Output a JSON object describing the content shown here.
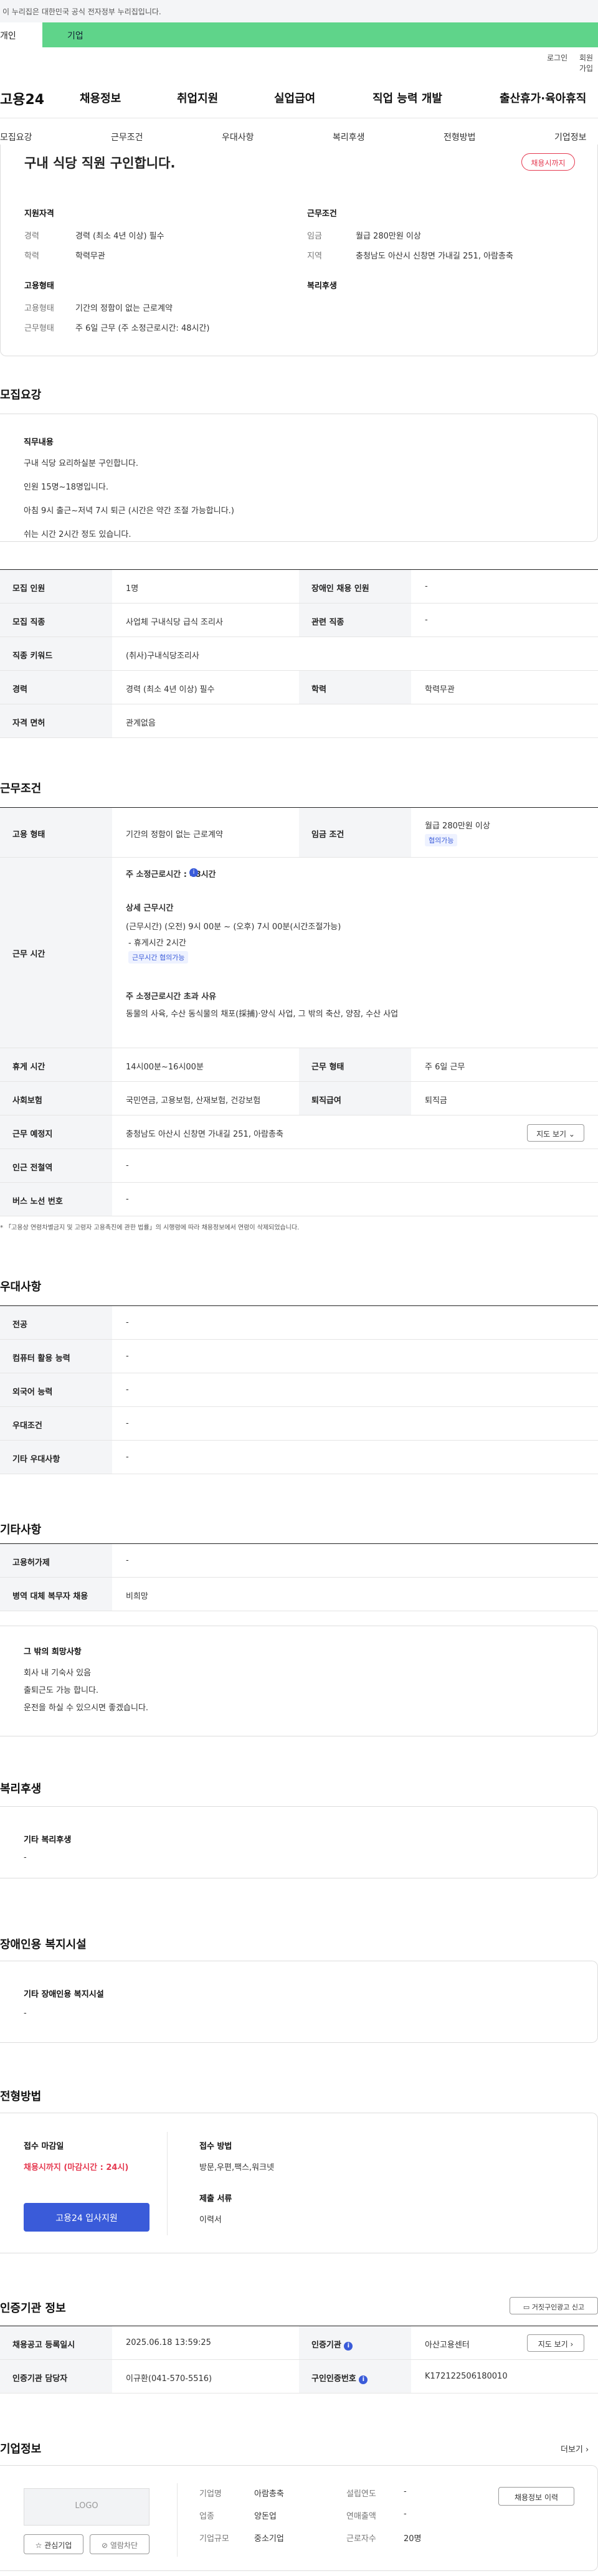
{
  "top_notice": "이 누리집은 대한민국 공식 전자정부 누리집입니다.",
  "role_tabs": {
    "left": "개인",
    "right": "기업"
  },
  "util": {
    "login": "로그인",
    "join": "회원가입"
  },
  "logo": "고용24",
  "gnb": [
    "채용정보",
    "취업지원",
    "실업급여",
    "직업 능력 개발",
    "출산휴가·육아휴직"
  ],
  "subnav": [
    "모집요강",
    "근무조건",
    "우대사항",
    "복리후생",
    "전형방법",
    "기업정보"
  ],
  "summary": {
    "title": "구내 식당 직원 구인합니다.",
    "status_badge": "채용시까지",
    "qual_title": "지원자격",
    "career_label": "경력",
    "career_value": "경력 (최소 4년 이상) 필수",
    "edu_label": "학력",
    "edu_value": "학력무관",
    "cond_title": "근무조건",
    "wage_label": "임금",
    "wage_value": "월급 280만원 이상",
    "region_label": "지역",
    "region_value": "충청남도 아산시 신창면 가내길 251, 아람총축",
    "emp_title": "고용형태",
    "emp_type_label": "고용형태",
    "emp_type_value": "기간의 정함이 없는 근로계약",
    "work_type_label": "근무형태",
    "work_type_value": "주 6일 근무 (주 소정근로시간: 48시간)",
    "welfare_title": "복리후생"
  },
  "recruit": {
    "heading": "모집요강",
    "desc_title": "직무내용",
    "desc_lines": [
      "구내 식당 요리하실분 구인합니다.",
      "인원 15명~18명입니다.",
      "아침 9시 출근~저녁 7시 퇴근 (시간은 약간 조절 가능합니다.)",
      "쉬는 시간 2시간 정도 있습니다."
    ],
    "rows": [
      {
        "k1": "모집 인원",
        "v1": "1명",
        "k2": "장애인 채용 인원",
        "v2": "-"
      },
      {
        "k1": "모집 직종",
        "v1": "사업체 구내식당 급식 조리사",
        "k2": "관련 직종",
        "v2": "-"
      },
      {
        "k1": "직종 키워드",
        "v1": "(취사)구내식당조리사",
        "k2": "",
        "v2": ""
      },
      {
        "k1": "경력",
        "v1": "경력 (최소 4년 이상) 필수",
        "k2": "학력",
        "v2": "학력무관"
      },
      {
        "k1": "자격 면허",
        "v1": "관계없음",
        "k2": "",
        "v2": ""
      }
    ]
  },
  "conditions": {
    "heading": "근무조건",
    "emp_type_k": "고용 형태",
    "emp_type_v": "기간의 정함이 없는 근로계약",
    "wage_k": "임금 조건",
    "wage_v": "월급 280만원 이상",
    "wage_badge": "협의가능",
    "hours_k": "근무 시간",
    "hours_total": "주 소정근로시간 : 48시간",
    "hours_detail_title": "상세 근무시간",
    "hours_detail_1": "(근무시간) (오전) 9시 00분 ~ (오후) 7시 00분(시간조절가능)",
    "hours_detail_2": "- 휴게시간 2시간",
    "hours_badge": "근무시간 협의가능",
    "hours_over_title": "주 소정근로시간 초과 사유",
    "hours_over_value": "동물의 사육, 수산 동식물의 채포(採捕)·양식 사업, 그 밖의 축산, 양잠, 수산 사업",
    "break_k": "휴게 시간",
    "break_v": "14시00분~16시00분",
    "workform_k": "근무 형태",
    "workform_v": "주 6일 근무",
    "insurance_k": "사회보험",
    "insurance_v": "국민연금, 고용보험, 산재보험, 건강보험",
    "severance_k": "퇴직급여",
    "severance_v": "퇴직금",
    "place_k": "근무 예정지",
    "place_v": "충청남도 아산시 신창면 가내길 251, 아람총축",
    "map_btn": "지도 보기",
    "subway_k": "인근 전철역",
    "subway_v": "-",
    "bus_k": "버스 노선 번호",
    "bus_v": "-",
    "footnote": "「고용상 연령차별금지 및 고령자 고용촉진에 관한 법률」의 시행령에 따라 채용정보에서 연령이 삭제되었습니다."
  },
  "preferences": {
    "heading": "우대사항",
    "rows": [
      {
        "k": "전공",
        "v": "-"
      },
      {
        "k": "컴퓨터 활용 능력",
        "v": "-"
      },
      {
        "k": "외국어 능력",
        "v": "-"
      },
      {
        "k": "우대조건",
        "v": "-"
      },
      {
        "k": "기타 우대사항",
        "v": "-"
      }
    ]
  },
  "others": {
    "heading": "기타사항",
    "rows": [
      {
        "k": "고용허가제",
        "v": "-"
      },
      {
        "k": "병역 대체 복무자 채용",
        "v": "비희망"
      }
    ],
    "box_title": "그 밖의 희망사항",
    "box_lines": [
      "회사 내 기숙사 있음",
      "출퇴근도 가능 합니다.",
      "운전을 하실 수 있으시면 좋겠습니다."
    ]
  },
  "welfare": {
    "heading": "복리후생",
    "box_title": "기타 복리후생",
    "box_value": "-"
  },
  "disability": {
    "heading": "장애인용 복지시설",
    "box_title": "기타 장애인용 복지시설",
    "box_value": "-"
  },
  "selection": {
    "heading": "전형방법",
    "deadline_title": "접수 마감일",
    "deadline_value": "채용시까지 (마감시간 : 24시)",
    "apply_btn": "고용24 입사지원",
    "method_title": "접수 방법",
    "method_value": "방문,우편,팩스,워크넷",
    "docs_title": "제출 서류",
    "docs_value": "이력서"
  },
  "agency": {
    "heading": "인증기관 정보",
    "report_btn": "거짓구인광고 신고",
    "reg_k": "채용공고 등록일시",
    "reg_v": "2025.06.18 13:59:25",
    "org_k": "인증기관",
    "org_v": "아산고용센터",
    "map_btn": "지도 보기",
    "mgr_k": "인증기관 담당자",
    "mgr_v": "이규환(041-570-5516)",
    "id_k": "구인인증번호",
    "id_v": "K172122506180010"
  },
  "company": {
    "heading": "기업정보",
    "more": "더보기",
    "logo_placeholder": "LOGO",
    "fav_btn": "관심기업",
    "block_btn": "열람차단",
    "name_k": "기업명",
    "name_v": "아람총축",
    "founded_k": "설립연도",
    "founded_v": "-",
    "biz_k": "업종",
    "biz_v": "양돈업",
    "revenue_k": "연매출액",
    "revenue_v": "-",
    "size_k": "기업규모",
    "size_v": "중소기업",
    "staff_k": "근로자수",
    "staff_v": "20명",
    "jobs_btn": "채용정보 이력"
  }
}
